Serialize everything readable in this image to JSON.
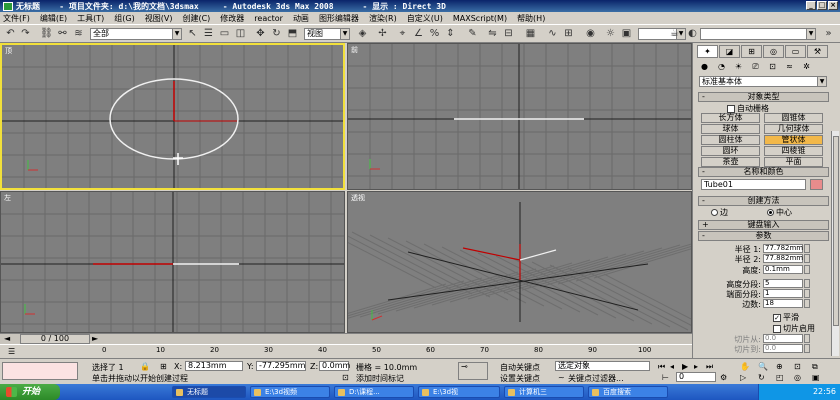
{
  "window": {
    "title": "无标题    - 项目文件夹: d:\\我的文档\\3dsmax     - Autodesk 3ds Max 2008      - 显示 : Direct 3D",
    "controls": [
      "_",
      "□",
      "×"
    ]
  },
  "menu": [
    "文件(F)",
    "编辑(E)",
    "工具(T)",
    "组(G)",
    "视图(V)",
    "创建(C)",
    "修改器",
    "reactor",
    "动画",
    "图形编辑器",
    "渲染(R)",
    "自定义(U)",
    "MAXScript(M)",
    "帮助(H)"
  ],
  "toolbar": {
    "selection_filter": "全部",
    "view_select": "视图"
  },
  "viewports": {
    "top": "顶",
    "front": "前",
    "left": "左",
    "perspective": "透视"
  },
  "panel": {
    "category_dropdown": "标准基本体",
    "object_type_title": "对象类型",
    "autogrid": "自动栅格",
    "objects": [
      {
        "label": "长方体",
        "active": false
      },
      {
        "label": "圆锥体",
        "active": false
      },
      {
        "label": "球体",
        "active": false
      },
      {
        "label": "几何球体",
        "active": false
      },
      {
        "label": "圆柱体",
        "active": false
      },
      {
        "label": "管状体",
        "active": true
      },
      {
        "label": "圆环",
        "active": false
      },
      {
        "label": "四棱锥",
        "active": false
      },
      {
        "label": "茶壶",
        "active": false
      },
      {
        "label": "平面",
        "active": false
      }
    ],
    "name_color_title": "名称和颜色",
    "object_name": "Tube01",
    "creation_method_title": "创建方法",
    "radio_edge": "边",
    "radio_center": "中心",
    "keyboard_entry_title": "键盘输入",
    "parameters_title": "参数",
    "params": [
      {
        "label": "半径 1:",
        "value": "77.782mm"
      },
      {
        "label": "半径 2:",
        "value": "77.882mm"
      },
      {
        "label": "高度:",
        "value": "0.1mm"
      },
      {
        "label": "高度分段:",
        "value": "5"
      },
      {
        "label": "端面分段:",
        "value": "1"
      },
      {
        "label": "边数:",
        "value": "18"
      }
    ],
    "smooth": "平滑",
    "slice_on": "切片启用",
    "slice_from_label": "切片从:",
    "slice_from": "0.0",
    "slice_to_label": "切片到:",
    "slice_to": "0.0"
  },
  "timeline": {
    "frame_display": "0 / 100",
    "ticks": [
      "0",
      "10",
      "20",
      "30",
      "40",
      "50",
      "60",
      "70",
      "80",
      "90",
      "100"
    ]
  },
  "status": {
    "selection_info": "选择了 1",
    "prompt": "单击并拖动以开始创建过程",
    "x_label": "X:",
    "x_value": "8.213mm",
    "y_label": "Y:",
    "y_value": "-77.295mm",
    "z_label": "Z:",
    "z_value": "0.0mm",
    "grid": "栅格 = 10.0mm",
    "add_time_tag": "添加时间标记",
    "auto_key": "自动关键点",
    "set_key": "设置关键点",
    "selected_object": "选定对象",
    "key_filters": "关键点过滤器...",
    "frame_value": "0"
  },
  "taskbar": {
    "start": "开始",
    "tasks": [
      "无标题",
      "E:\\3d视频",
      "D:\\课程...",
      "E:\\3d视",
      "计算机三",
      "百度搜索"
    ],
    "time": "22:56"
  }
}
